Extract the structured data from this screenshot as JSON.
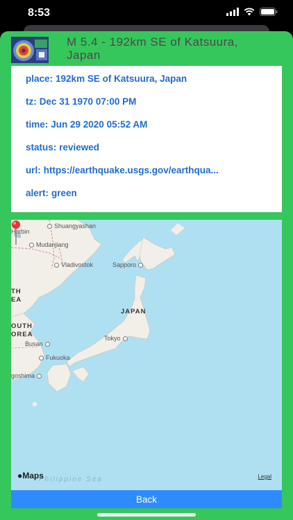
{
  "status_bar": {
    "time": "8:53"
  },
  "header": {
    "title": "M 5.4 - 192km SE of Katsuura, Japan"
  },
  "info": {
    "rows": [
      {
        "key": "place:",
        "value": "192km SE of Katsuura, Japan"
      },
      {
        "key": "tz:",
        "value": "Dec 31 1970 07:00 PM"
      },
      {
        "key": "time:",
        "value": "Jun 29 2020 05:52 AM"
      },
      {
        "key": "status:",
        "value": "reviewed"
      },
      {
        "key": "url:",
        "value": "https://earthquake.usgs.gov/earthqua..."
      },
      {
        "key": "alert:",
        "value": "green"
      }
    ]
  },
  "map": {
    "labels": {
      "harbin": "Harbin",
      "shuangyashan": "Shuangyashan",
      "mudanjiang": "Mudanjiang",
      "vladivostok": "Vladivostok",
      "sapporo": "Sapporo",
      "japan": "JAPAN",
      "tokyo": "Tokyo",
      "busan": "Busan",
      "fukuoka": "Fukuoka",
      "kagoshima": "goshima",
      "north1": "TH",
      "north2": "EA",
      "south1": "OUTH",
      "south2": "OREA",
      "sea": "Philippine Sea"
    },
    "provider": "Maps",
    "legal": "Legal"
  },
  "back_button": {
    "label": "Back"
  },
  "colors": {
    "accent_green": "#36c75c",
    "text_blue": "#1f6bd1",
    "button_blue": "#2e8bff",
    "ocean": "#aee0f2",
    "land": "#f2efe8"
  }
}
